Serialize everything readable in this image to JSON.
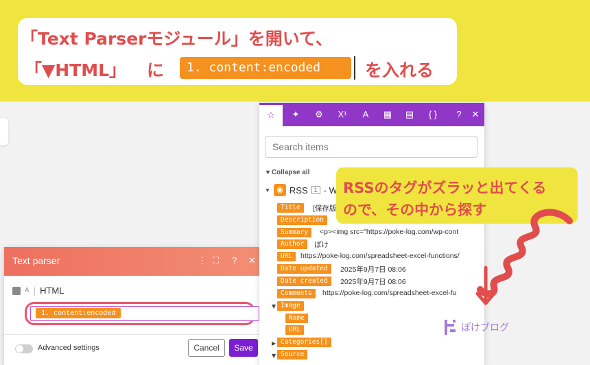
{
  "banner": {
    "line1": "「Text Parserモジュール」を開いて、",
    "line2_start": "「▼HTML」",
    "line2_mid": "に",
    "code": "1. content:encoded",
    "line2_end": "を入れる"
  },
  "text_parser": {
    "title": "Text parser",
    "header_icons": [
      "⋮",
      "⛶",
      "?",
      "✕"
    ],
    "field_label": "HTML",
    "field_value": "1. content:encoded",
    "advanced_label": "Advanced settings",
    "cancel_label": "Cancel",
    "save_label": "Save"
  },
  "mapping": {
    "toolbar": [
      "☆",
      "✦",
      "⚙",
      "X¹",
      "A",
      "▦",
      "▤",
      "{ }",
      "?",
      "✕"
    ],
    "search_placeholder": "Search items",
    "collapse_label": "Collapse all",
    "rss_label": "RSS",
    "rss_num": "1",
    "rss_suffix": "- W",
    "items": [
      {
        "tag": "Title",
        "value": "[保存版"
      },
      {
        "tag": "Description",
        "value": ""
      },
      {
        "tag": "Summary",
        "value": "<p><img src=\"https://poke-log.com/wp-cont"
      },
      {
        "tag": "Author",
        "value": "ぽけ"
      },
      {
        "tag": "URL",
        "value": "https://poke-log.com/spreadsheet-excel-functions/"
      },
      {
        "tag": "Date updated",
        "value": "2025年9月7日 08:06"
      },
      {
        "tag": "Date created",
        "value": "2025年9月7日 08:06"
      },
      {
        "tag": "Comments",
        "value": "https://poke-log.com/spreadsheet-excel-fu"
      },
      {
        "tag": "Image",
        "value": ""
      },
      {
        "tag": "Name",
        "value": ""
      },
      {
        "tag": "URL",
        "value": ""
      },
      {
        "tag": "Categories[]",
        "value": ""
      },
      {
        "tag": "Source",
        "value": ""
      }
    ]
  },
  "note": {
    "line1": "RSSのタグがズラッと出てくる",
    "line2": "ので、その中から探す"
  },
  "logo": {
    "text": "ぽけブログ"
  },
  "colors": {
    "background": "#f0e53e",
    "accent_red": "#e14d4d",
    "tag_orange": "#f5911e",
    "toolbar_purple": "#9137c8",
    "save_purple": "#7b1fd0"
  }
}
